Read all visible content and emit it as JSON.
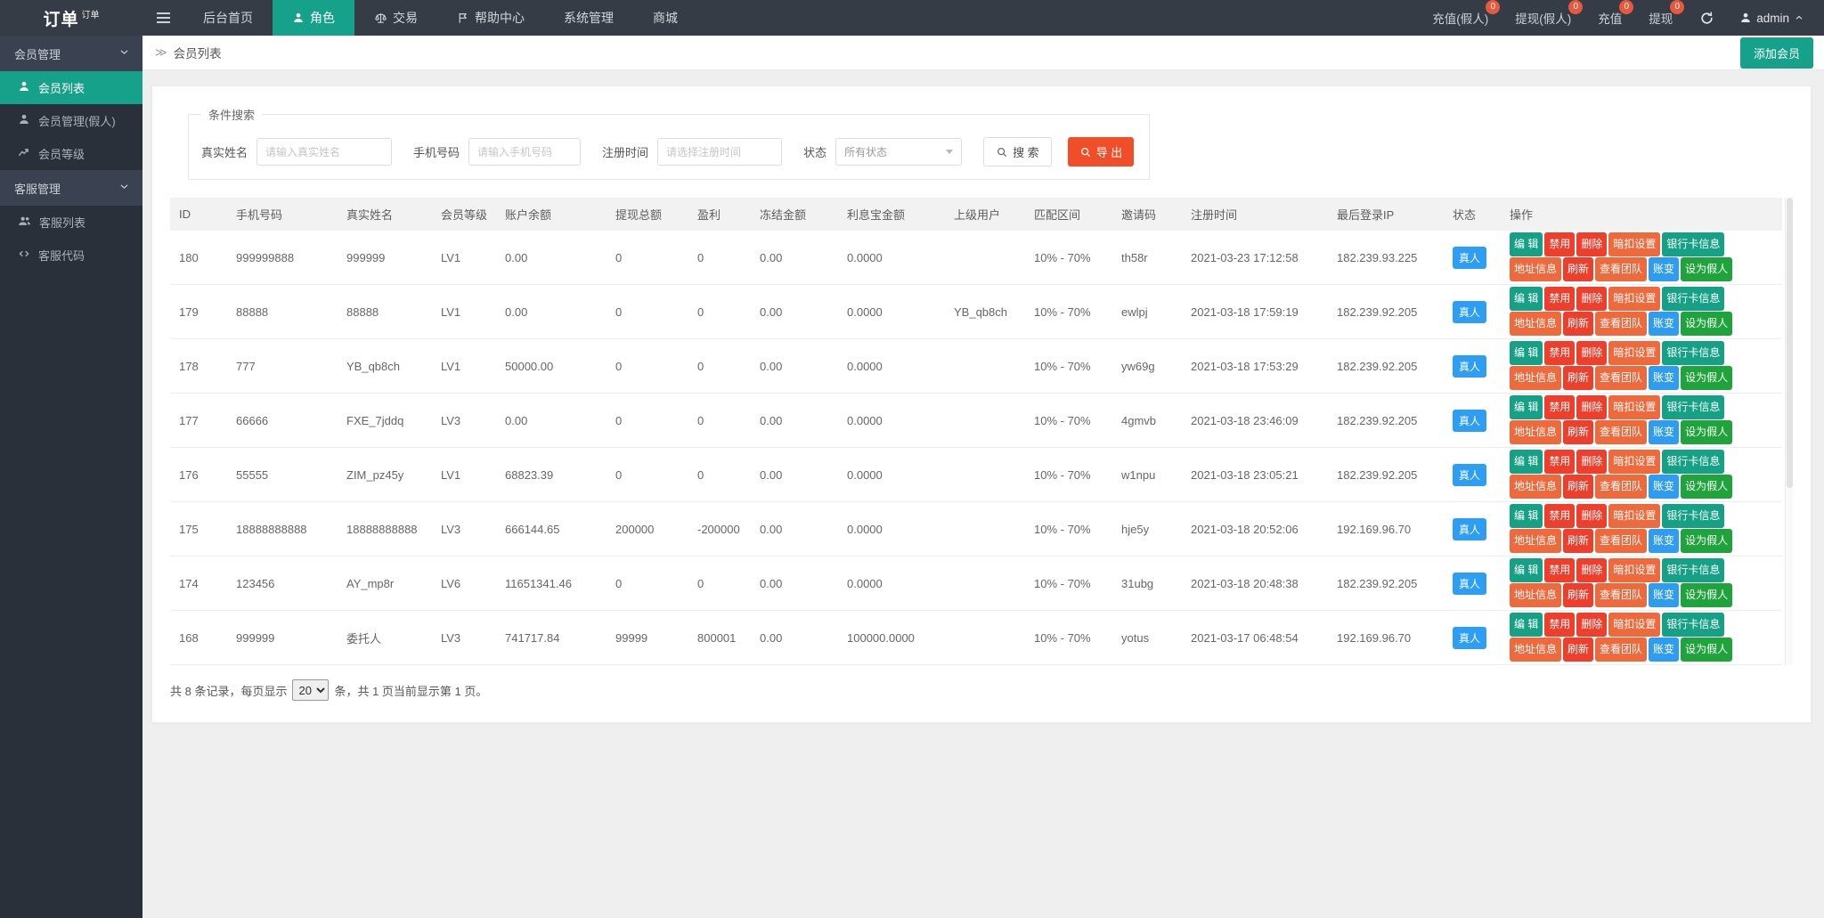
{
  "navbar": {
    "logo": "订单",
    "logo_sup": "订单",
    "items": [
      {
        "label": "后台首页",
        "icon": null,
        "active": false
      },
      {
        "label": "角色",
        "icon": "person",
        "active": true
      },
      {
        "label": "交易",
        "icon": "scales",
        "active": false
      },
      {
        "label": "帮助中心",
        "icon": "flag",
        "active": false
      },
      {
        "label": "系统管理",
        "icon": null,
        "active": false
      },
      {
        "label": "商城",
        "icon": null,
        "active": false
      }
    ],
    "right_items": [
      {
        "label": "充值(假人)",
        "badge": "0"
      },
      {
        "label": "提现(假人)",
        "badge": "0"
      },
      {
        "label": "充值",
        "badge": "0"
      },
      {
        "label": "提现",
        "badge": "0"
      }
    ],
    "user": "admin"
  },
  "sidebar": {
    "sections": [
      {
        "label": "会员管理",
        "items": [
          {
            "label": "会员列表",
            "icon": "person",
            "active": true
          },
          {
            "label": "会员管理(假人)",
            "icon": "person",
            "active": false
          },
          {
            "label": "会员等级",
            "icon": "trend",
            "active": false
          }
        ]
      },
      {
        "label": "客服管理",
        "items": [
          {
            "label": "客服列表",
            "icon": "users",
            "active": false
          },
          {
            "label": "客服代码",
            "icon": "code",
            "active": false
          }
        ]
      }
    ]
  },
  "breadcrumb": {
    "icon": "≫",
    "title": "会员列表",
    "add_button": "添加会员"
  },
  "search": {
    "legend": "条件搜索",
    "fields": [
      {
        "label": "真实姓名",
        "placeholder": "请输入真实姓名"
      },
      {
        "label": "手机号码",
        "placeholder": "请输入手机号码"
      },
      {
        "label": "注册时间",
        "placeholder": "请选择注册时间"
      }
    ],
    "status_label": "状态",
    "status_value": "所有状态",
    "search_button": "搜 索",
    "export_button": "导 出"
  },
  "table": {
    "headers": [
      "ID",
      "手机号码",
      "真实姓名",
      "会员等级",
      "账户余额",
      "提现总额",
      "盈利",
      "冻结金额",
      "利息宝金额",
      "上级用户",
      "匹配区间",
      "邀请码",
      "注册时间",
      "最后登录IP",
      "状态",
      "操作"
    ],
    "status_badge": "真人",
    "actions_row1": [
      {
        "label": "编 辑",
        "color": "teal",
        "name": "edit-button"
      },
      {
        "label": "禁用",
        "color": "red",
        "name": "disable-button"
      },
      {
        "label": "删除",
        "color": "red",
        "name": "delete-button"
      },
      {
        "label": "暗扣设置",
        "color": "orange",
        "name": "hidden-deduction-settings-button"
      },
      {
        "label": "银行卡信息",
        "color": "teal",
        "name": "bank-card-info-button"
      }
    ],
    "actions_row2": [
      {
        "label": "地址信息",
        "color": "orange",
        "name": "address-info-button"
      },
      {
        "label": "刷新",
        "color": "red",
        "name": "refresh-row-button"
      },
      {
        "label": "查看团队",
        "color": "orange",
        "name": "view-team-button"
      },
      {
        "label": "账变",
        "color": "blue",
        "name": "account-change-button"
      },
      {
        "label": "设为假人",
        "color": "green",
        "name": "set-as-bot-button"
      }
    ],
    "rows": [
      [
        "180",
        "999999888",
        "999999",
        "LV1",
        "0.00",
        "0",
        "0",
        "0.00",
        "0.0000",
        "",
        "10% - 70%",
        "th58r",
        "2021-03-23 17:12:58",
        "182.239.93.225"
      ],
      [
        "179",
        "88888",
        "88888",
        "LV1",
        "0.00",
        "0",
        "0",
        "0.00",
        "0.0000",
        "YB_qb8ch",
        "10% - 70%",
        "ewlpj",
        "2021-03-18 17:59:19",
        "182.239.92.205"
      ],
      [
        "178",
        "777",
        "YB_qb8ch",
        "LV1",
        "50000.00",
        "0",
        "0",
        "0.00",
        "0.0000",
        "",
        "10% - 70%",
        "yw69g",
        "2021-03-18 17:53:29",
        "182.239.92.205"
      ],
      [
        "177",
        "66666",
        "FXE_7jddq",
        "LV3",
        "0.00",
        "0",
        "0",
        "0.00",
        "0.0000",
        "",
        "10% - 70%",
        "4gmvb",
        "2021-03-18 23:46:09",
        "182.239.92.205"
      ],
      [
        "176",
        "55555",
        "ZIM_pz45y",
        "LV1",
        "68823.39",
        "0",
        "0",
        "0.00",
        "0.0000",
        "",
        "10% - 70%",
        "w1npu",
        "2021-03-18 23:05:21",
        "182.239.92.205"
      ],
      [
        "175",
        "18888888888",
        "18888888888",
        "LV3",
        "666144.65",
        "200000",
        "-200000",
        "0.00",
        "0.0000",
        "",
        "10% - 70%",
        "hje5y",
        "2021-03-18 20:52:06",
        "192.169.96.70"
      ],
      [
        "174",
        "123456",
        "AY_mp8r",
        "LV6",
        "11651341.46",
        "0",
        "0",
        "0.00",
        "0.0000",
        "",
        "10% - 70%",
        "31ubg",
        "2021-03-18 20:48:38",
        "182.239.92.205"
      ],
      [
        "168",
        "999999",
        "委托人",
        "LV3",
        "741717.84",
        "99999",
        "800001",
        "0.00",
        "100000.0000",
        "",
        "10% - 70%",
        "yotus",
        "2021-03-17 06:48:54",
        "192.169.96.70"
      ]
    ]
  },
  "pagination": {
    "prefix": "共 8 条记录，每页显示",
    "page_size": "20",
    "suffix": "条，共 1 页当前显示第 1 页。"
  },
  "colors": {
    "navbar": "#363c46",
    "sidebar": "#2a303a",
    "sideheader": "#3a4150",
    "accent": "#16a28a",
    "badge": "#e8583c",
    "export": "#f04e28",
    "teal": "#16a085",
    "red": "#ee3f2d",
    "orange": "#ee6a3c",
    "blue": "#2e9cf0",
    "green": "#1fa33b",
    "status": "#2e9ef5"
  }
}
